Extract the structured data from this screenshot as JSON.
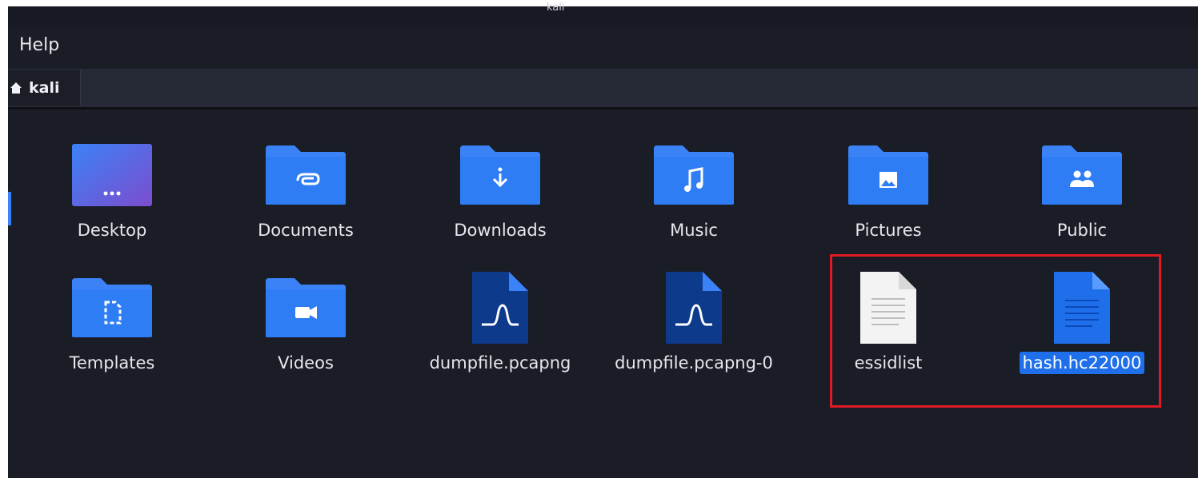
{
  "window": {
    "title": "kali"
  },
  "menu": {
    "help_label": "Help"
  },
  "path": {
    "home_label": "kali"
  },
  "colors": {
    "folder": "#3b82f6",
    "folder_dark": "#2563eb",
    "selection": "#1f6feb",
    "highlight": "#e01b24"
  },
  "files": [
    {
      "name": "Desktop",
      "icon": "desktop-folder-icon"
    },
    {
      "name": "Documents",
      "icon": "documents-folder-icon"
    },
    {
      "name": "Downloads",
      "icon": "downloads-folder-icon"
    },
    {
      "name": "Music",
      "icon": "music-folder-icon"
    },
    {
      "name": "Pictures",
      "icon": "pictures-folder-icon"
    },
    {
      "name": "Public",
      "icon": "public-folder-icon"
    },
    {
      "name": "Templates",
      "icon": "templates-folder-icon"
    },
    {
      "name": "Videos",
      "icon": "videos-folder-icon"
    },
    {
      "name": "dumpfile.pcapng",
      "icon": "pcap-file-icon"
    },
    {
      "name": "dumpfile.pcapng-0",
      "icon": "pcap-file-icon"
    },
    {
      "name": "essidlist",
      "icon": "text-file-icon"
    },
    {
      "name": "hash.hc22000",
      "icon": "document-file-icon",
      "selected": true
    }
  ]
}
